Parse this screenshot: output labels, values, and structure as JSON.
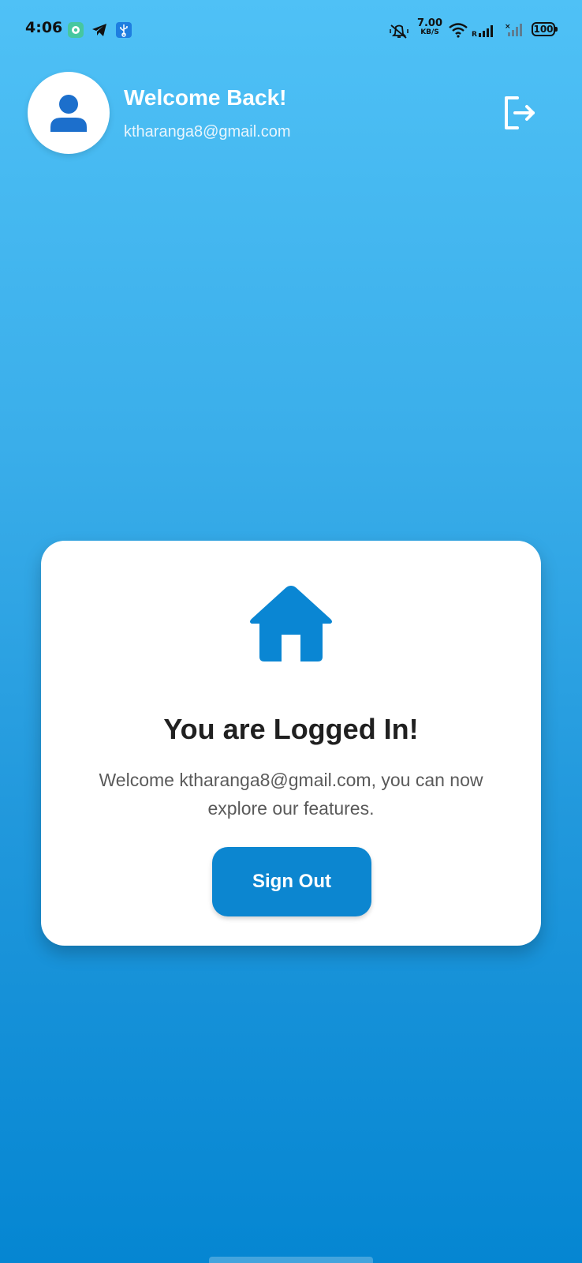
{
  "status_bar": {
    "time": "4:06",
    "net_speed_value": "7.00",
    "net_speed_unit": "KB/S",
    "battery": "100",
    "icons": [
      "chat-app-icon",
      "telegram-icon",
      "usb-icon",
      "vibrate-mute-icon",
      "wifi-icon",
      "signal-icon",
      "signal-no-service-icon"
    ]
  },
  "header": {
    "title": "Welcome Back!",
    "email": "ktharanga8@gmail.com",
    "avatar_icon": "person-icon",
    "logout_icon": "logout-icon"
  },
  "card": {
    "icon": "home-icon",
    "title": "You are Logged In!",
    "message": "Welcome ktharanga8@gmail.com, you can now explore our features.",
    "button_label": "Sign Out"
  },
  "colors": {
    "gradient_top": "#4fc1f6",
    "gradient_bottom": "#0586d2",
    "accent": "#0c86d0",
    "card_bg": "#ffffff"
  }
}
